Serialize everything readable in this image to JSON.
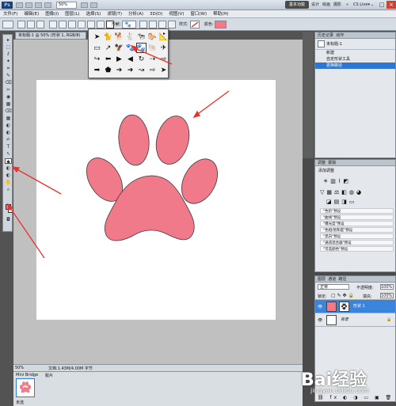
{
  "app": {
    "logo": "Ps",
    "zoom": "50%",
    "workspaces": [
      "基本功能",
      "设计",
      "绘画",
      "摄影"
    ],
    "active_workspace": "基本功能",
    "more": "»",
    "cs_live": "CS Live▾",
    "win_min": "–",
    "win_max": "□",
    "win_close": "×"
  },
  "menubar": [
    "文件(F)",
    "编辑(E)",
    "图像(I)",
    "图层(L)",
    "选择(S)",
    "滤镜(T)",
    "分析(A)",
    "3D(D)",
    "视图(V)",
    "窗口(W)",
    "帮助(H)"
  ],
  "options": {
    "shape_label": "形状:",
    "style_label": "样式:",
    "color_label": "颜色:",
    "accent_color": "#f07a8a"
  },
  "document": {
    "tab_title": "未标题-1 @ 50% (形状 1, RGB/8)",
    "close": "×",
    "status_zoom": "50%",
    "status_doc": "文档:1.43M/4.00M 字节"
  },
  "shape_picker": {
    "icons": [
      "➤",
      "🐈",
      "🐕",
      "🐇",
      "🐄",
      "🐎",
      "📐",
      "▭",
      "↗",
      "🦅",
      "🐾",
      "🐾",
      "🐚",
      "✈",
      "↪",
      "⬅",
      "▶",
      "◀",
      "↻",
      "⇢",
      "⇨",
      "➡",
      "⬟",
      "➔",
      "➜",
      "↝",
      "⇨",
      "➤"
    ],
    "selected_index": 11,
    "menu_arrow": "▸"
  },
  "tools": [
    "▸",
    "⬚",
    "ℓ",
    "✦",
    "⌗",
    "✎",
    "⌫",
    "✂",
    "◉",
    "▦",
    "◐",
    "✍",
    "T",
    "↖",
    "◆",
    "✋",
    "⌕"
  ],
  "history_panel": {
    "tabs": [
      "历史记录",
      "动作",
      "字符"
    ],
    "snapshot": "未标题-1",
    "items": [
      "新建",
      "自定形状工具",
      "更换路径"
    ]
  },
  "adjustments_panel": {
    "tabs": [
      "调整",
      "蒙版"
    ],
    "title": "添加调整",
    "presets": [
      "\"色阶\"预设",
      "\"曲线\"预设",
      "\"曝光度\"预设",
      "\"色相/饱和度\"预设",
      "\"黑白\"预设",
      "\"通道混合器\"预设",
      "\"可选颜色\"预设"
    ]
  },
  "layers_panel": {
    "tabs": [
      "图层",
      "通道",
      "路径"
    ],
    "blend_mode": "正常",
    "opacity_label": "不透明度:",
    "opacity": "100%",
    "lock_label": "锁定:",
    "fill_label": "填充:",
    "fill": "100%",
    "layers": [
      {
        "name": "形状 1",
        "selected": true
      },
      {
        "name": "背景",
        "selected": false
      }
    ]
  },
  "mini_bridge": {
    "tabs": [
      "Mini Bridge",
      "Tm",
      "胶片"
    ],
    "footer": "未选"
  },
  "watermark": {
    "brand": "Bai经验",
    "url": "jingyan.baidu.com"
  }
}
